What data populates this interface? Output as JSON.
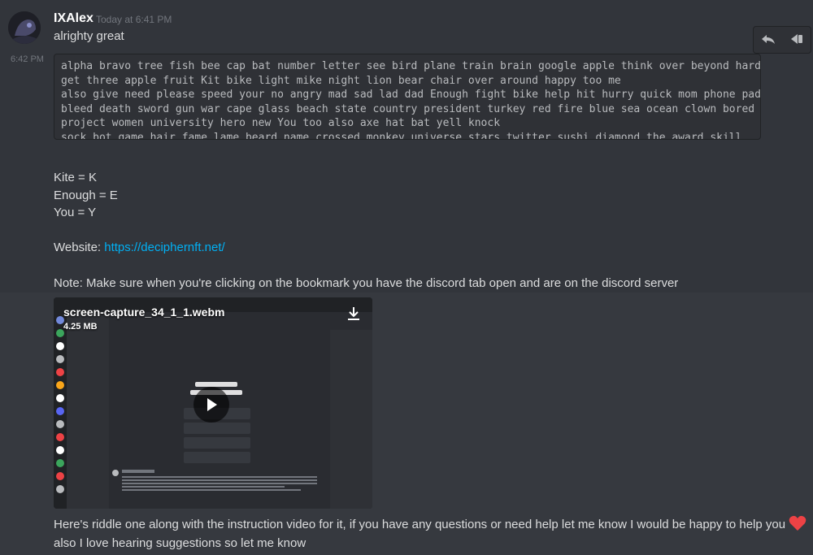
{
  "message": {
    "author": "IXAlex",
    "timestamp": "Today at 6:41 PM",
    "first_line": "alrighty great",
    "second_time": "6:42 PM",
    "code_lines": [
      "alpha bravo tree fish bee cap bat number letter see bird plane train brain google apple think over beyond harder",
      "get three apple fruit Kit bike light mike night lion bear chair over around happy too me",
      "also give need please speed your no angry mad sad lad dad Enough fight bike help hit hurry quick mom phone pad deep",
      "bleed death sword gun war cape glass beach state country president turkey red fire blue sea ocean clown bored lord",
      "project women university hero new You too also axe hat bat yell knock",
      "sock bot game hair fame lame beard name crossed monkey universe stars twitter sushi diamond the award skill"
    ],
    "legend": [
      "Kite = K",
      "Enough = E",
      "You = Y"
    ],
    "website_label": "Website: ",
    "website_url": "https://deciphernft.net/",
    "note": "Note: Make sure when you're clicking on the bookmark you have the discord tab open and are on the discord server",
    "attachment": {
      "file_name": "screen-capture_34_1_1.webm",
      "file_size": "4.25 MB"
    },
    "closing_line1": "Here's riddle one along with the instruction video for it, if you have any questions or need help let me know I would be happy to help you",
    "closing_line2": "also I love hearing suggestions so let me know"
  },
  "toolbar": {
    "reply_icon": "reply-icon",
    "more_icon": "more-icon"
  },
  "colors": {
    "background": "#36393f",
    "code_bg": "#2f3136",
    "link": "#00b0f4",
    "heart": "#ed4245"
  }
}
